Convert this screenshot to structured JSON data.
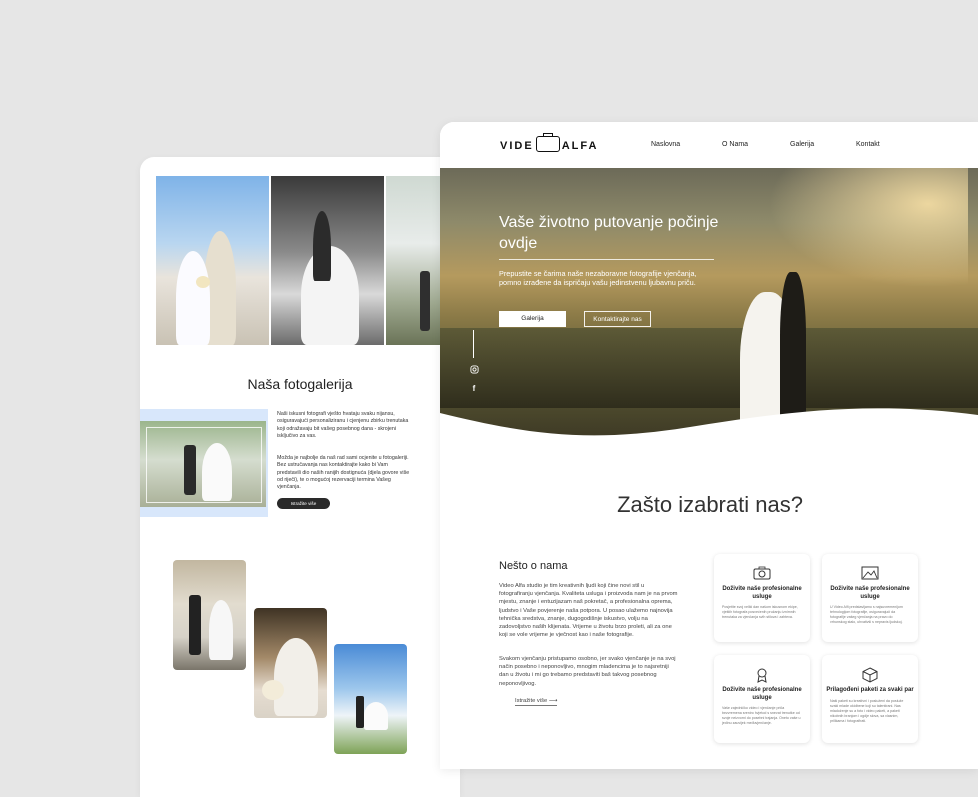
{
  "back_page": {
    "gallery_title": "Naša fotogalerija",
    "gallery_text_1": "Naši iskusni fotografi vješto hvataju svaku nijansu, osiguravajući personaliziranu i cjenjenu zbirku trenutaka koji odražavaju bit vašeg posebnog dana - skrojeni isključivo za vas.",
    "gallery_text_2": "Možda je najbolje da naš rad sami ocjenite u fotogaleriji. Bez ustručavanja nas kontaktirajte kako bi Vam predstavili dio naših ranijih dostignuća (djela govore više od riječi), te o mogućoj rezervaciji termina Vašeg vjenčanja.",
    "gallery_button": "Istražite više"
  },
  "nav": {
    "logo_left": "VIDE",
    "logo_right": "ALFA",
    "links": [
      "Naslovna",
      "O Nama",
      "Galerija",
      "Kontakt"
    ]
  },
  "hero": {
    "title": "Vaše životno putovanje počinje ovdje",
    "subtitle": "Prepustite se čarima naše nezaboravne fotografije vjenčanja, pomno izrađene da ispričaju vašu jedinstvenu ljubavnu priču.",
    "btn_gallery": "Galerija",
    "btn_contact": "Kontaktirajte nas"
  },
  "why": {
    "title": "Zašto izabrati nas?",
    "about_title": "Nešto o nama",
    "about_p1": "Video Alfa studio je tim kreativnih ljudi koji čine novi stil u fotografiranju vjenčanja. Kvaliteta usluga i proizvoda nam je na prvom mjestu, znanje i entuzijazam naš pokretač, a profesionalna oprema, ljudstvo i Vaše povjerenje naša potpora. U posao ulažemo najnovija tehnička sredstva, znanje, dugogodišnje iskustvo, volju na zadovoljstvo naših klijenata. Vrijeme u životu brzo proleti, ali za one koji se vole vrijeme je vječnost kao i naše fotografije.",
    "about_p2": "Svakom vjenčanju pristupamo osobno, jer svako vjenčanje je na svoj način posebno i neponovljivo, mnogim mladencima je to najsretniji dan u životu i mi go trebamo predstaviti baš takvog posebnog neponovljivog.",
    "more": "Istražite više",
    "cards": [
      {
        "icon": "camera-icon",
        "title": "Doživite naše profesionalne usluge",
        "desc": "Posjetite svoj veliki dan našom iskusnom ekipe, vještih fotografa posvećenih pružanju iznimnih trenutaka za vjenčanja svih stilova i zahteva."
      },
      {
        "icon": "image-icon",
        "title": "Doživite naše profesionalne usluge",
        "desc": "U Video Alfi predstavljamo s najsuvremenijom tehnologijom fotografije, osiguravajući da fotografije vašeg vjenčanja na pravo do vrhunskog stalo, uhvativši s nepravis ljudskoj."
      },
      {
        "icon": "award-icon",
        "title": "Doživite naše profesionalne usluge",
        "desc": "Vaše zajedničko video i vjenčanje priča bezvremena sreniro hvjetod s snevat trenutke od svoje neizvorni do posebni trajanja. Oneto vaše u jedinu zauvijek međuvjenčanje."
      },
      {
        "icon": "package-icon",
        "title": "Prilagođeni paketi za svaki par",
        "desc": "Naši paketi su kreativni i posluženi da posluže svaki mlade okidbene koji su talentirani. Nas mladoženje su a foto i video paketi, a paketi nikobnih branjom i ogdje slova, sa vlasnim, prilikama i fotografirati."
      }
    ]
  }
}
